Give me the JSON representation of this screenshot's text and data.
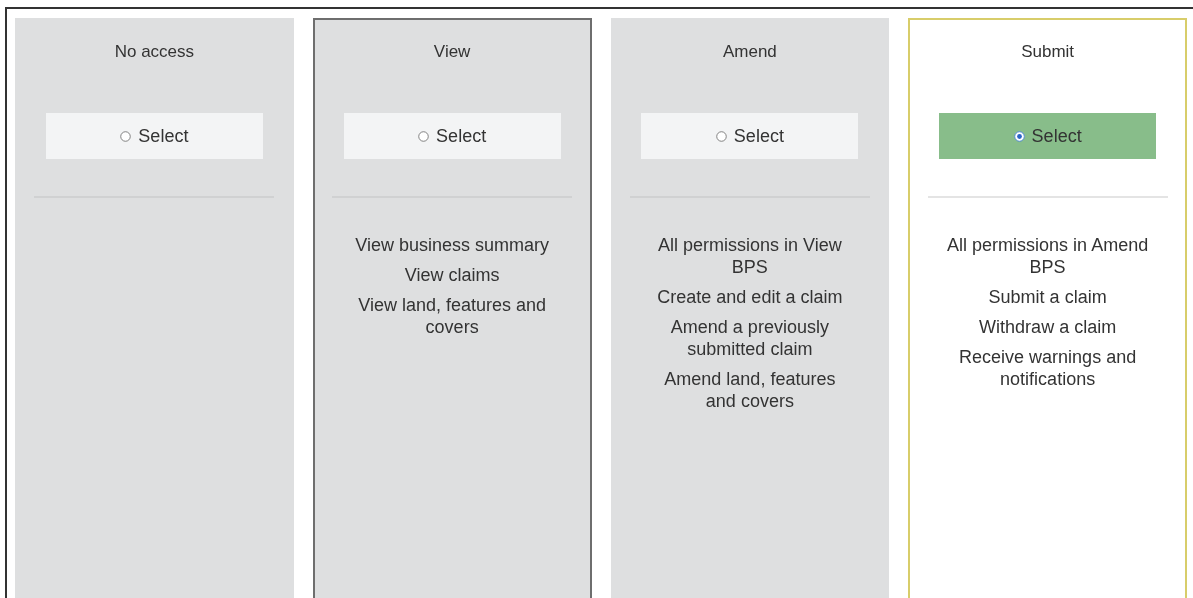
{
  "options": [
    {
      "title": "No access",
      "button": "Select",
      "selected": false,
      "focused": false
    },
    {
      "title": "View",
      "button": "Select",
      "selected": false,
      "focused": true,
      "permissions": [
        "View business summary",
        "View claims",
        "View land, features and covers"
      ]
    },
    {
      "title": "Amend",
      "button": "Select",
      "selected": false,
      "focused": false,
      "permissions": [
        "All permissions in View BPS",
        "Create and edit a claim",
        "Amend a previously submitted claim",
        "Amend land, features and covers"
      ]
    },
    {
      "title": "Submit",
      "button": "Select",
      "selected": true,
      "focused": false,
      "permissions": [
        "All permissions in Amend BPS",
        "Submit a claim",
        "Withdraw a claim",
        "Receive warnings and notifications"
      ]
    }
  ]
}
